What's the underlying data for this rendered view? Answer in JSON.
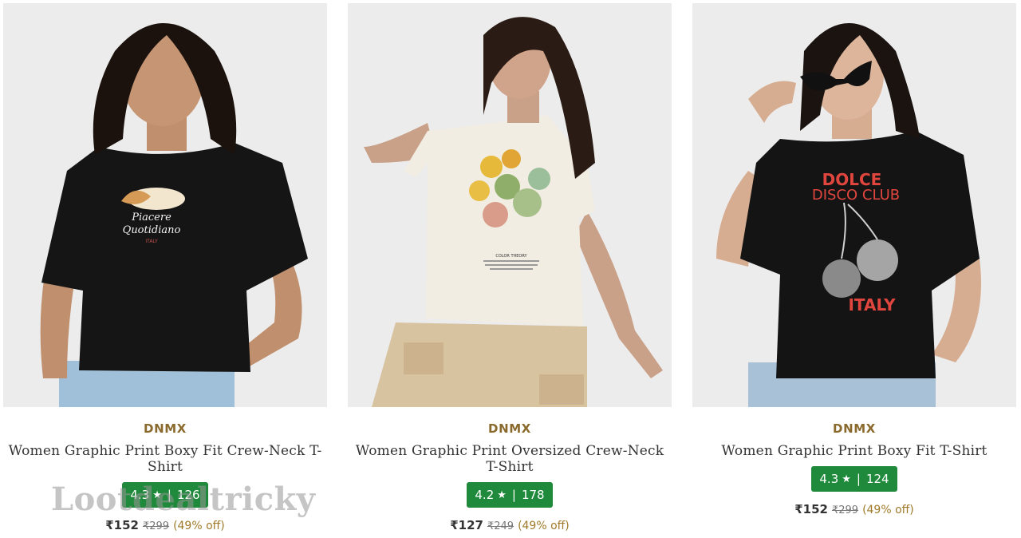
{
  "products": [
    {
      "brand": "DNMX",
      "title": "Women Graphic Print Boxy Fit Crew-Neck T-Shirt",
      "rating": "4.3",
      "star": "★",
      "sep": "|",
      "reviews": "126",
      "price": "₹152",
      "mrp": "₹299",
      "discount": "(49% off)",
      "print_lines": [
        "Piacere",
        "Quotidiano",
        "ITALY"
      ]
    },
    {
      "brand": "DNMX",
      "title": "Women Graphic Print Oversized Crew-Neck T-Shirt",
      "rating": "4.2",
      "star": "★",
      "sep": "|",
      "reviews": "178",
      "price": "₹127",
      "mrp": "₹249",
      "discount": "(49% off)",
      "print_lines": [
        "COLOR THEORY"
      ]
    },
    {
      "brand": "DNMX",
      "title": "Women Graphic Print Boxy Fit T-Shirt",
      "rating": "4.3",
      "star": "★",
      "sep": "|",
      "reviews": "124",
      "price": "₹152",
      "mrp": "₹299",
      "discount": "(49% off)",
      "print_lines": [
        "DOLCE",
        "DISCO CLUB",
        "ITALY"
      ]
    }
  ],
  "watermark": "Lootdealtricky",
  "colors": {
    "brand": "#8a6a2c",
    "rating_bg": "#1f8a3b",
    "discount": "#a07a2a"
  }
}
